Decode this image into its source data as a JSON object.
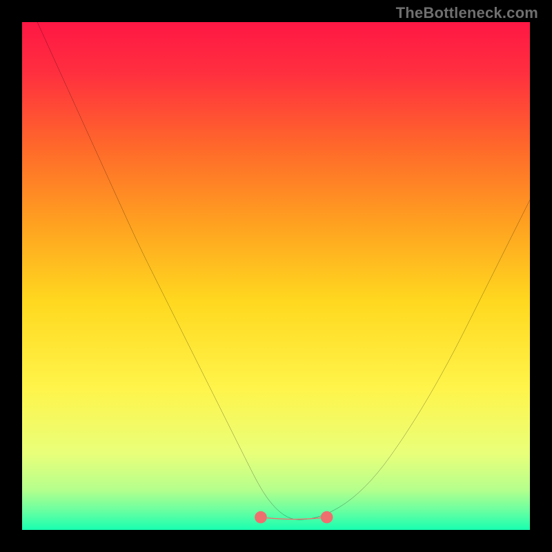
{
  "watermark": "TheBottleneck.com",
  "chart_data": {
    "type": "line",
    "title": "",
    "xlabel": "",
    "ylabel": "",
    "xlim": [
      0,
      100
    ],
    "ylim": [
      0,
      100
    ],
    "axes_visible": false,
    "grid": false,
    "gradient_stops": [
      {
        "offset": 0.0,
        "color": "#ff1744"
      },
      {
        "offset": 0.1,
        "color": "#ff2f3f"
      },
      {
        "offset": 0.25,
        "color": "#ff6a2a"
      },
      {
        "offset": 0.4,
        "color": "#ffa220"
      },
      {
        "offset": 0.55,
        "color": "#ffd81f"
      },
      {
        "offset": 0.72,
        "color": "#fff44a"
      },
      {
        "offset": 0.85,
        "color": "#e9ff7a"
      },
      {
        "offset": 0.92,
        "color": "#b6ff8c"
      },
      {
        "offset": 0.96,
        "color": "#6dffa0"
      },
      {
        "offset": 1.0,
        "color": "#18ffb0"
      }
    ],
    "series": [
      {
        "name": "bottleneck-curve",
        "color": "#000000",
        "x": [
          3,
          8,
          13,
          18,
          23,
          28,
          33,
          38,
          43,
          47,
          50,
          53,
          56,
          60,
          65,
          70,
          75,
          80,
          85,
          90,
          95,
          100
        ],
        "y": [
          100,
          89,
          78,
          67,
          56,
          46,
          36,
          26,
          16,
          8,
          4,
          2,
          2,
          3,
          6,
          11,
          18,
          26,
          35,
          45,
          55,
          65
        ]
      }
    ],
    "flat_segment": {
      "description": "Highlighted near-zero bottleneck region along the valley floor",
      "color": "#ef6f6f",
      "x": [
        47,
        60
      ],
      "y": [
        2.5,
        2.5
      ],
      "endpoint_radius": 1.2
    }
  }
}
